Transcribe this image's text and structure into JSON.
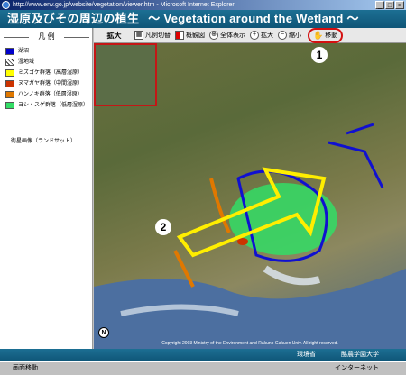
{
  "window": {
    "title": "http://www.env.go.jp/website/vegetation/viewer.htm - Microsoft Internet Explorer",
    "controls": [
      "_",
      "□",
      "×"
    ]
  },
  "header": {
    "title_ja": "湿原及びその周辺の植生",
    "title_en": "～ Vegetation around the Wetland ～"
  },
  "legend": {
    "title": "凡 例",
    "items": [
      {
        "label": "湖沼",
        "color": "#0000cc"
      },
      {
        "label": "湿地域",
        "color": "hatch"
      },
      {
        "label": "ミズゴケ群落（高層湿原）",
        "color": "#ffff00"
      },
      {
        "label": "ヌマガヤ群落（中間湿原）",
        "color": "#cc3300"
      },
      {
        "label": "ハンノキ群落（低層湿原）",
        "color": "#e07800"
      },
      {
        "label": "ヨシ・スゲ群落（低層湿原）",
        "color": "#33dd66"
      }
    ],
    "landsat_label": "衛星画像（ランドサット）"
  },
  "toolbar": {
    "zoom_label": "拡大",
    "legend_toggle": "凡例切替",
    "hide_overview": "概観図",
    "show_all": "全体表示",
    "zoom_in": "拡大",
    "zoom_out": "縮小",
    "move": "移動"
  },
  "map": {
    "copyright": "Copyright 2003 Ministry of the Environment and Rakuno Gakuen Univ. All right reserved.",
    "north": "N"
  },
  "callouts": {
    "one": "1",
    "two": "2"
  },
  "footer": {
    "org1": "環境省",
    "org2": "酪農学園大学"
  },
  "status": {
    "left": "画面移動",
    "right": "インターネット"
  },
  "colors": {
    "accent": "#0f5577",
    "highlight": "#d41010",
    "arrow": "#ffee00"
  }
}
